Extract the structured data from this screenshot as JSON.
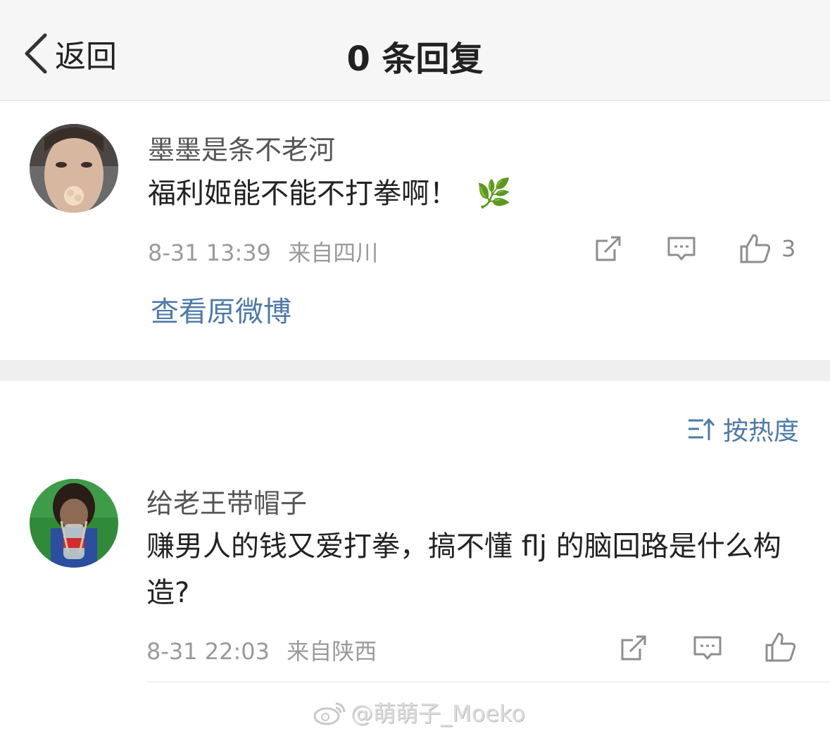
{
  "nav": {
    "back_label": "返回",
    "title": "0 条回复"
  },
  "comment": {
    "username": "墨墨是条不老河",
    "text": "福利姬能不能不打拳啊！",
    "emoji": "🌿",
    "time": "8-31 13:39",
    "location": "来自四川",
    "like_count": "3",
    "view_original": "查看原微博"
  },
  "sort": {
    "label": "按热度"
  },
  "replies": [
    {
      "username": "给老王带帽子",
      "text": "赚男人的钱又爱打拳，搞不懂 flj 的脑回路是什么构造?",
      "time": "8-31 22:03",
      "location": "来自陕西"
    }
  ],
  "watermark": {
    "text": "@萌萌子_Moeko"
  },
  "colors": {
    "link": "#4d7aa8",
    "meta": "#9a9a9a",
    "navbar_bg": "#f6f6f6"
  }
}
